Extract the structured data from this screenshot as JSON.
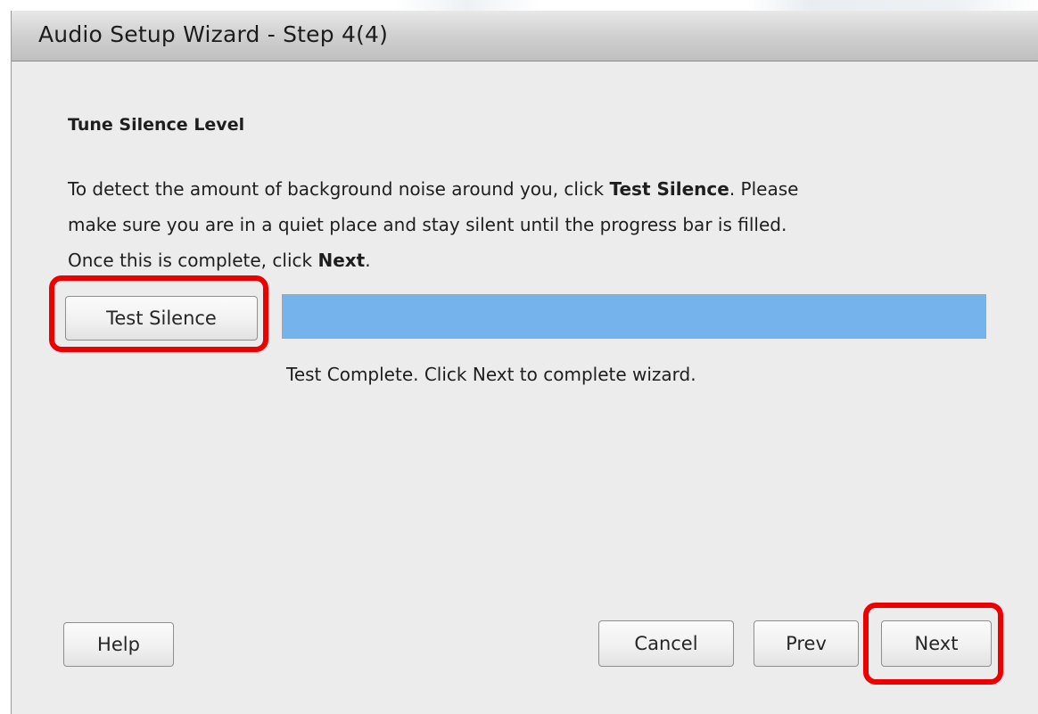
{
  "window": {
    "title": "Audio Setup Wizard - Step 4(4)"
  },
  "content": {
    "heading": "Tune Silence Level",
    "instructions": {
      "line1_prefix": "To detect the amount of background noise around you, click ",
      "line1_bold": "Test Silence",
      "line1_suffix": ". Please",
      "line2": "make sure you are in a quiet place and stay silent until the progress bar is filled.",
      "line3_prefix": "Once this is complete, click ",
      "line3_bold": "Next",
      "line3_suffix": "."
    },
    "test_button_label": "Test Silence",
    "progress_percent": 100,
    "status_text": "Test Complete. Click Next to complete wizard."
  },
  "footer": {
    "help_label": "Help",
    "cancel_label": "Cancel",
    "prev_label": "Prev",
    "next_label": "Next"
  },
  "colors": {
    "highlight": "#ee0000",
    "progress_fill": "#74b3ec"
  }
}
